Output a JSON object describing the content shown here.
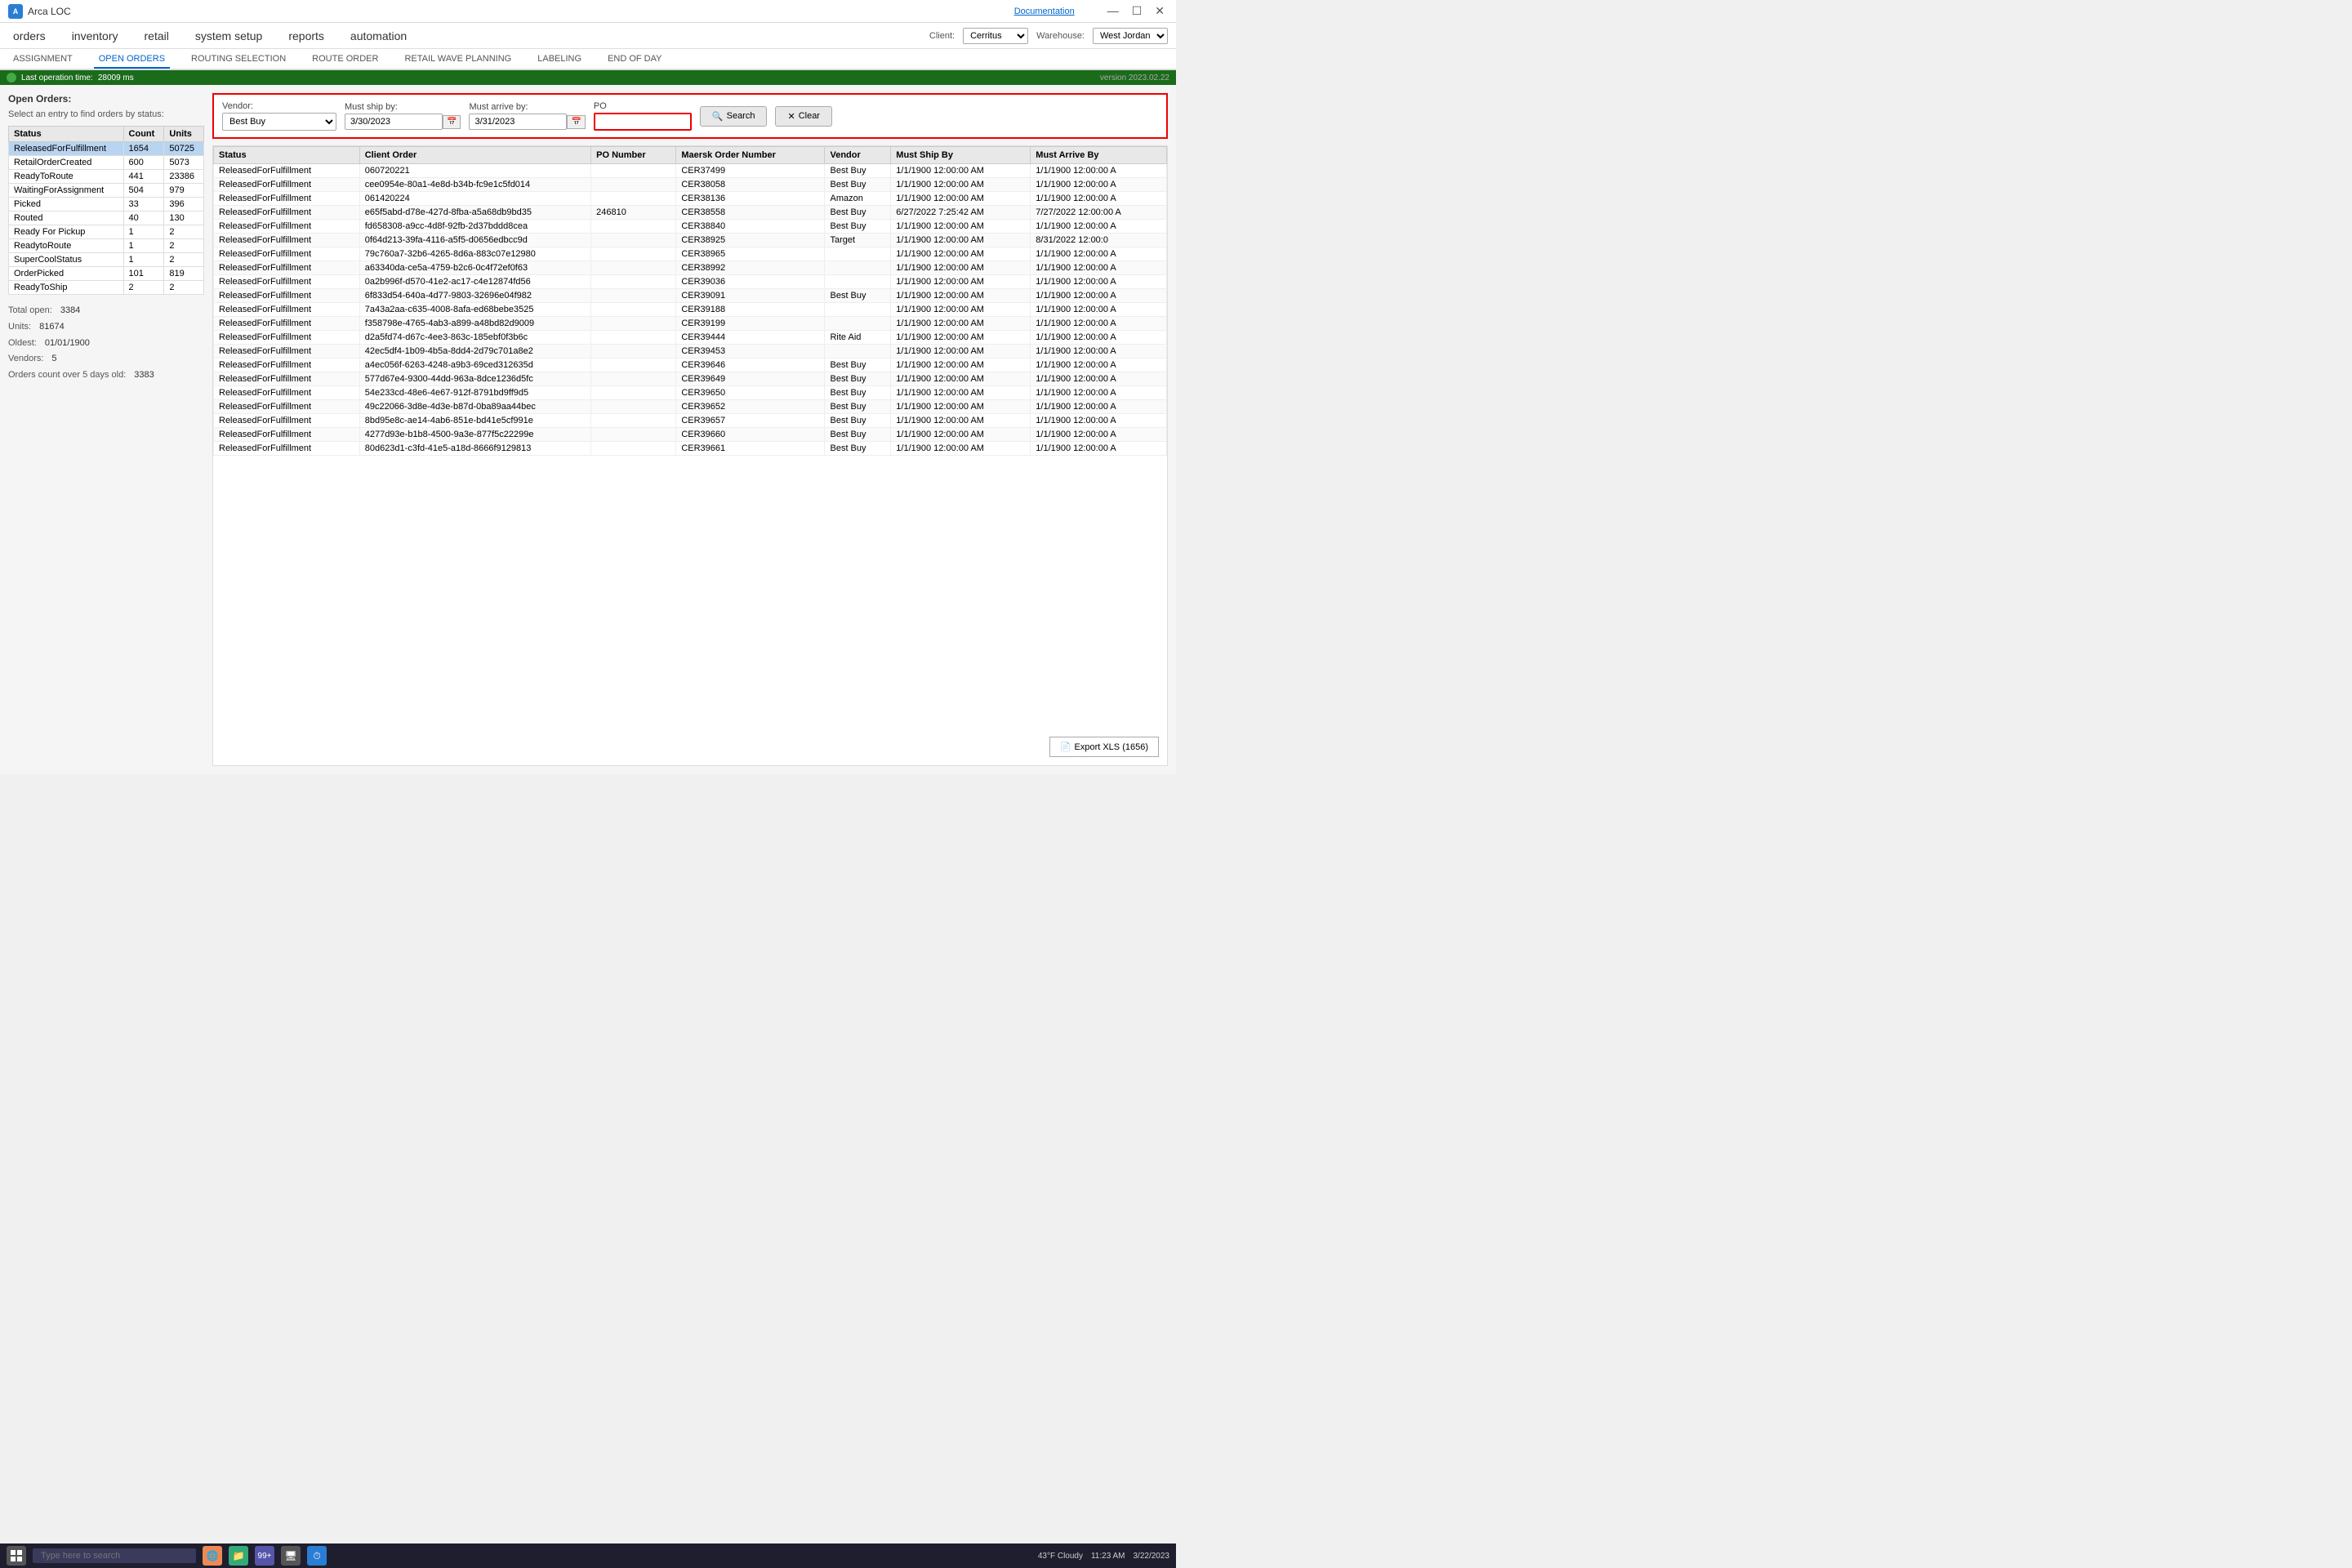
{
  "app": {
    "title": "Arca LOC",
    "icon_text": "A",
    "doc_link": "Documentation"
  },
  "titlebar": {
    "minimize": "—",
    "maximize": "☐",
    "close": "✕"
  },
  "menu": {
    "items": [
      "orders",
      "inventory",
      "retail",
      "system setup",
      "reports",
      "automation"
    ],
    "client_label": "Client:",
    "client_value": "Cerritus",
    "warehouse_label": "Warehouse:",
    "warehouse_value": "West Jordan"
  },
  "subnav": {
    "items": [
      "ASSIGNMENT",
      "OPEN ORDERS",
      "ROUTING SELECTION",
      "ROUTE ORDER",
      "RETAIL WAVE PLANNING",
      "LABELING",
      "END OF DAY"
    ],
    "active": "OPEN ORDERS"
  },
  "left_panel": {
    "title": "Open Orders:",
    "subtitle": "Select an entry to find orders by status:",
    "columns": [
      "Status",
      "Count",
      "Units"
    ],
    "rows": [
      {
        "status": "ReleasedForFulfillment",
        "count": "1654",
        "units": "50725",
        "selected": true
      },
      {
        "status": "RetailOrderCreated",
        "count": "600",
        "units": "5073",
        "selected": false
      },
      {
        "status": "ReadyToRoute",
        "count": "441",
        "units": "23386",
        "selected": false
      },
      {
        "status": "WaitingForAssignment",
        "count": "504",
        "units": "979",
        "selected": false
      },
      {
        "status": "Picked",
        "count": "33",
        "units": "396",
        "selected": false
      },
      {
        "status": "Routed",
        "count": "40",
        "units": "130",
        "selected": false
      },
      {
        "status": "Ready For Pickup",
        "count": "1",
        "units": "2",
        "selected": false
      },
      {
        "status": "ReadytoRoute",
        "count": "1",
        "units": "2",
        "selected": false
      },
      {
        "status": "SuperCoolStatus",
        "count": "1",
        "units": "2",
        "selected": false
      },
      {
        "status": "OrderPicked",
        "count": "101",
        "units": "819",
        "selected": false
      },
      {
        "status": "ReadyToShip",
        "count": "2",
        "units": "2",
        "selected": false
      }
    ],
    "summary": {
      "total_open_label": "Total open:",
      "total_open_value": "3384",
      "units_label": "Units:",
      "units_value": "81674",
      "oldest_label": "Oldest:",
      "oldest_value": "01/01/1900",
      "vendors_label": "Vendors:",
      "vendors_value": "5",
      "orders_over_5_label": "Orders count over 5 days old:",
      "orders_over_5_value": "3383"
    }
  },
  "filter": {
    "vendor_label": "Vendor:",
    "vendor_value": "Best Buy",
    "vendor_options": [
      "Best Buy",
      "Amazon",
      "Target",
      "Rite Aid"
    ],
    "must_ship_label": "Must ship by:",
    "must_ship_value": "3/30/2023",
    "must_arrive_label": "Must arrive by:",
    "must_arrive_value": "3/31/2023",
    "po_label": "PO",
    "po_placeholder": "",
    "search_btn": "Search",
    "clear_btn": "Clear"
  },
  "data_table": {
    "columns": [
      "Status",
      "Client Order",
      "PO Number",
      "Maersk Order Number",
      "Vendor",
      "Must Ship By",
      "Must Arrive By"
    ],
    "rows": [
      {
        "status": "ReleasedForFulfillment",
        "client_order": "060720221",
        "po_number": "",
        "maersk": "CER37499",
        "vendor": "Best Buy",
        "must_ship": "1/1/1900 12:00:00 AM",
        "must_arrive": "1/1/1900 12:00:00 A"
      },
      {
        "status": "ReleasedForFulfillment",
        "client_order": "cee0954e-80a1-4e8d-b34b-fc9e1c5fd014",
        "po_number": "",
        "maersk": "CER38058",
        "vendor": "Best Buy",
        "must_ship": "1/1/1900 12:00:00 AM",
        "must_arrive": "1/1/1900 12:00:00 A"
      },
      {
        "status": "ReleasedForFulfillment",
        "client_order": "061420224",
        "po_number": "",
        "maersk": "CER38136",
        "vendor": "Amazon",
        "must_ship": "1/1/1900 12:00:00 AM",
        "must_arrive": "1/1/1900 12:00:00 A"
      },
      {
        "status": "ReleasedForFulfillment",
        "client_order": "e65f5abd-d78e-427d-8fba-a5a68db9bd35",
        "po_number": "246810",
        "maersk": "CER38558",
        "vendor": "Best Buy",
        "must_ship": "6/27/2022 7:25:42 AM",
        "must_arrive": "7/27/2022 12:00:00 A"
      },
      {
        "status": "ReleasedForFulfillment",
        "client_order": "fd658308-a9cc-4d8f-92fb-2d37bddd8cea",
        "po_number": "",
        "maersk": "CER38840",
        "vendor": "Best Buy",
        "must_ship": "1/1/1900 12:00:00 AM",
        "must_arrive": "1/1/1900 12:00:00 A"
      },
      {
        "status": "ReleasedForFulfillment",
        "client_order": "0f64d213-39fa-4116-a5f5-d0656edbcc9d",
        "po_number": "",
        "maersk": "CER38925",
        "vendor": "Target",
        "must_ship": "1/1/1900 12:00:00 AM",
        "must_arrive": "8/31/2022 12:00:0"
      },
      {
        "status": "ReleasedForFulfillment",
        "client_order": "79c760a7-32b6-4265-8d6a-883c07e12980",
        "po_number": "",
        "maersk": "CER38965",
        "vendor": "",
        "must_ship": "1/1/1900 12:00:00 AM",
        "must_arrive": "1/1/1900 12:00:00 A"
      },
      {
        "status": "ReleasedForFulfillment",
        "client_order": "a63340da-ce5a-4759-b2c6-0c4f72ef0f63",
        "po_number": "",
        "maersk": "CER38992",
        "vendor": "",
        "must_ship": "1/1/1900 12:00:00 AM",
        "must_arrive": "1/1/1900 12:00:00 A"
      },
      {
        "status": "ReleasedForFulfillment",
        "client_order": "0a2b996f-d570-41e2-ac17-c4e12874fd56",
        "po_number": "",
        "maersk": "CER39036",
        "vendor": "",
        "must_ship": "1/1/1900 12:00:00 AM",
        "must_arrive": "1/1/1900 12:00:00 A"
      },
      {
        "status": "ReleasedForFulfillment",
        "client_order": "6f833d54-640a-4d77-9803-32696e04f982",
        "po_number": "",
        "maersk": "CER39091",
        "vendor": "Best Buy",
        "must_ship": "1/1/1900 12:00:00 AM",
        "must_arrive": "1/1/1900 12:00:00 A"
      },
      {
        "status": "ReleasedForFulfillment",
        "client_order": "7a43a2aa-c635-4008-8afa-ed68bebe3525",
        "po_number": "",
        "maersk": "CER39188",
        "vendor": "",
        "must_ship": "1/1/1900 12:00:00 AM",
        "must_arrive": "1/1/1900 12:00:00 A"
      },
      {
        "status": "ReleasedForFulfillment",
        "client_order": "f358798e-4765-4ab3-a899-a48bd82d9009",
        "po_number": "",
        "maersk": "CER39199",
        "vendor": "",
        "must_ship": "1/1/1900 12:00:00 AM",
        "must_arrive": "1/1/1900 12:00:00 A"
      },
      {
        "status": "ReleasedForFulfillment",
        "client_order": "d2a5fd74-d67c-4ee3-863c-185ebf0f3b6c",
        "po_number": "",
        "maersk": "CER39444",
        "vendor": "Rite Aid",
        "must_ship": "1/1/1900 12:00:00 AM",
        "must_arrive": "1/1/1900 12:00:00 A"
      },
      {
        "status": "ReleasedForFulfillment",
        "client_order": "42ec5df4-1b09-4b5a-8dd4-2d79c701a8e2",
        "po_number": "",
        "maersk": "CER39453",
        "vendor": "",
        "must_ship": "1/1/1900 12:00:00 AM",
        "must_arrive": "1/1/1900 12:00:00 A"
      },
      {
        "status": "ReleasedForFulfillment",
        "client_order": "a4ec056f-6263-4248-a9b3-69ced312635d",
        "po_number": "",
        "maersk": "CER39646",
        "vendor": "Best Buy",
        "must_ship": "1/1/1900 12:00:00 AM",
        "must_arrive": "1/1/1900 12:00:00 A"
      },
      {
        "status": "ReleasedForFulfillment",
        "client_order": "577d67e4-9300-44dd-963a-8dce1236d5fc",
        "po_number": "",
        "maersk": "CER39649",
        "vendor": "Best Buy",
        "must_ship": "1/1/1900 12:00:00 AM",
        "must_arrive": "1/1/1900 12:00:00 A"
      },
      {
        "status": "ReleasedForFulfillment",
        "client_order": "54e233cd-48e6-4e67-912f-8791bd9ff9d5",
        "po_number": "",
        "maersk": "CER39650",
        "vendor": "Best Buy",
        "must_ship": "1/1/1900 12:00:00 AM",
        "must_arrive": "1/1/1900 12:00:00 A"
      },
      {
        "status": "ReleasedForFulfillment",
        "client_order": "49c22066-3d8e-4d3e-b87d-0ba89aa44bec",
        "po_number": "",
        "maersk": "CER39652",
        "vendor": "Best Buy",
        "must_ship": "1/1/1900 12:00:00 AM",
        "must_arrive": "1/1/1900 12:00:00 A"
      },
      {
        "status": "ReleasedForFulfillment",
        "client_order": "8bd95e8c-ae14-4ab6-851e-bd41e5cf991e",
        "po_number": "",
        "maersk": "CER39657",
        "vendor": "Best Buy",
        "must_ship": "1/1/1900 12:00:00 AM",
        "must_arrive": "1/1/1900 12:00:00 A"
      },
      {
        "status": "ReleasedForFulfillment",
        "client_order": "4277d93e-b1b8-4500-9a3e-877f5c22299e",
        "po_number": "",
        "maersk": "CER39660",
        "vendor": "Best Buy",
        "must_ship": "1/1/1900 12:00:00 AM",
        "must_arrive": "1/1/1900 12:00:00 A"
      },
      {
        "status": "ReleasedForFulfillment",
        "client_order": "80d623d1-c3fd-41e5-a18d-8666f9129813",
        "po_number": "",
        "maersk": "CER39661",
        "vendor": "Best Buy",
        "must_ship": "1/1/1900 12:00:00 AM",
        "must_arrive": "1/1/1900 12:00:00 A"
      }
    ],
    "export_btn": "Export XLS (1656)"
  },
  "statusbar": {
    "operation_time_label": "Last operation time:",
    "operation_time_value": "28009 ms",
    "version": "version 2023.02.22"
  },
  "taskbar": {
    "search_placeholder": "Type here to search",
    "time": "11:23 AM",
    "date": "3/22/2023",
    "weather": "43°F  Cloudy"
  }
}
